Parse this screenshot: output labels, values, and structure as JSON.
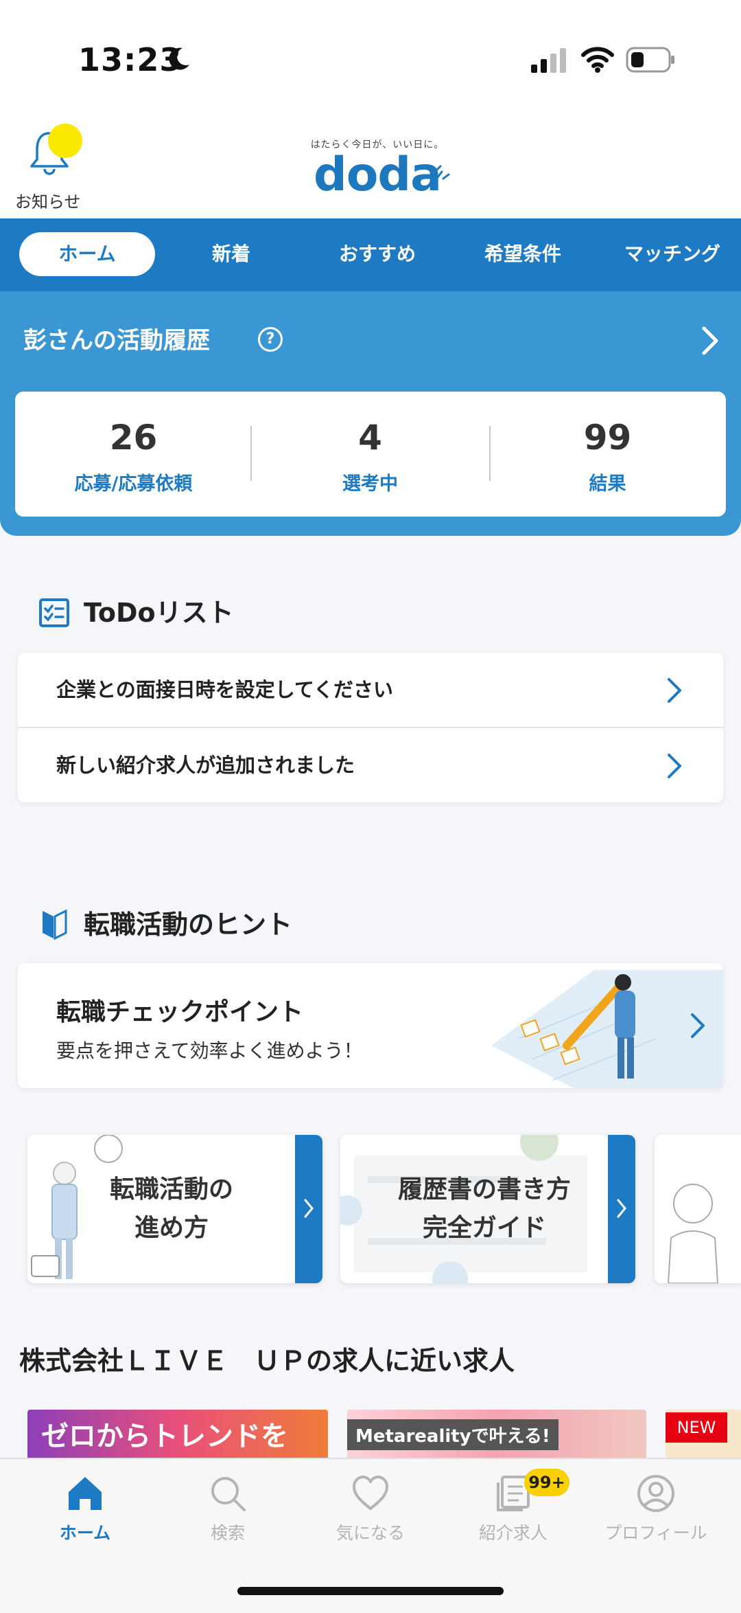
{
  "status_bar": {
    "time": "13:23"
  },
  "header": {
    "notice_label": "お知らせ",
    "logo_tagline": "はたらく今日が、いい日に。",
    "logo_text": "doda"
  },
  "tabs": [
    {
      "label": "ホーム",
      "active": true
    },
    {
      "label": "新着"
    },
    {
      "label": "おすすめ"
    },
    {
      "label": "希望条件"
    },
    {
      "label": "マッチング"
    }
  ],
  "activity": {
    "title": "彭さんの活動履歴",
    "help_glyph": "?",
    "stats": [
      {
        "value": "26",
        "label": "応募/応募依頼"
      },
      {
        "value": "4",
        "label": "選考中"
      },
      {
        "value": "99",
        "label": "結果"
      }
    ]
  },
  "todo": {
    "title": "ToDoリスト",
    "items": [
      {
        "text": "企業との面接日時を設定してください"
      },
      {
        "text": "新しい紹介求人が追加されました"
      }
    ]
  },
  "hints": {
    "title": "転職活動のヒント",
    "card": {
      "title": "転職チェックポイント",
      "subtitle": "要点を押さえて効率よく進めよう！"
    },
    "guides": [
      {
        "line1": "転職活動の",
        "line2": "進め方"
      },
      {
        "line1": "履歴書の書き方",
        "line2": "完全ガイド"
      }
    ]
  },
  "jobs": {
    "title": "株式会社ＬＩＶＥ　ＵＰの求人に近い求人",
    "banners": [
      {
        "text": "ゼロからトレンドを"
      },
      {
        "text": "Metarealityで叶える!"
      }
    ],
    "new_badge": "NEW"
  },
  "bottom_nav": {
    "items": [
      {
        "label": "ホーム",
        "icon": "home-icon",
        "active": true
      },
      {
        "label": "検索",
        "icon": "search-icon"
      },
      {
        "label": "気になる",
        "icon": "heart-icon"
      },
      {
        "label": "紹介求人",
        "icon": "document-icon",
        "badge": "99+"
      },
      {
        "label": "プロフィール",
        "icon": "profile-icon"
      }
    ]
  },
  "colors": {
    "brand": "#1e7ac2",
    "panel": "#3a97d3",
    "badge": "#fbd000",
    "notice_dot": "#fbe800",
    "new": "#e60012"
  }
}
